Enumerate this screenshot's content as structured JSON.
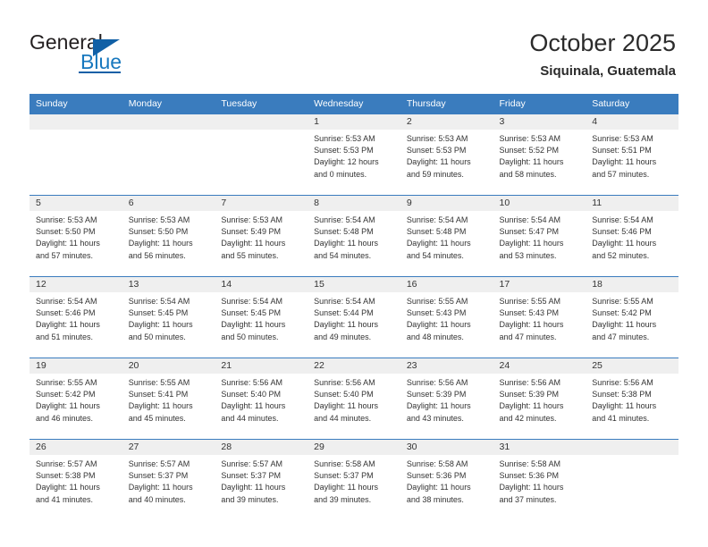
{
  "brand": {
    "name_part1": "General",
    "name_part2": "Blue",
    "accent_color": "#1160a6",
    "blue_text_color": "#1878be"
  },
  "header": {
    "title": "October 2025",
    "subtitle": "Siquinala, Guatemala"
  },
  "theme": {
    "header_row_bg": "#3a7cbe",
    "header_row_text": "#ffffff",
    "daynum_band_bg": "#efefef",
    "cell_bg": "#ffffff",
    "text_color": "#333333"
  },
  "labels": {
    "sunrise_prefix": "Sunrise:",
    "sunset_prefix": "Sunset:",
    "daylight_prefix": "Daylight:"
  },
  "weekday_headers": [
    "Sunday",
    "Monday",
    "Tuesday",
    "Wednesday",
    "Thursday",
    "Friday",
    "Saturday"
  ],
  "weeks": [
    [
      {
        "day": "",
        "sunrise": "",
        "sunset": "",
        "daylight_line1": "",
        "daylight_line2": ""
      },
      {
        "day": "",
        "sunrise": "",
        "sunset": "",
        "daylight_line1": "",
        "daylight_line2": ""
      },
      {
        "day": "",
        "sunrise": "",
        "sunset": "",
        "daylight_line1": "",
        "daylight_line2": ""
      },
      {
        "day": "1",
        "sunrise": "Sunrise: 5:53 AM",
        "sunset": "Sunset: 5:53 PM",
        "daylight_line1": "Daylight: 12 hours",
        "daylight_line2": "and 0 minutes."
      },
      {
        "day": "2",
        "sunrise": "Sunrise: 5:53 AM",
        "sunset": "Sunset: 5:53 PM",
        "daylight_line1": "Daylight: 11 hours",
        "daylight_line2": "and 59 minutes."
      },
      {
        "day": "3",
        "sunrise": "Sunrise: 5:53 AM",
        "sunset": "Sunset: 5:52 PM",
        "daylight_line1": "Daylight: 11 hours",
        "daylight_line2": "and 58 minutes."
      },
      {
        "day": "4",
        "sunrise": "Sunrise: 5:53 AM",
        "sunset": "Sunset: 5:51 PM",
        "daylight_line1": "Daylight: 11 hours",
        "daylight_line2": "and 57 minutes."
      }
    ],
    [
      {
        "day": "5",
        "sunrise": "Sunrise: 5:53 AM",
        "sunset": "Sunset: 5:50 PM",
        "daylight_line1": "Daylight: 11 hours",
        "daylight_line2": "and 57 minutes."
      },
      {
        "day": "6",
        "sunrise": "Sunrise: 5:53 AM",
        "sunset": "Sunset: 5:50 PM",
        "daylight_line1": "Daylight: 11 hours",
        "daylight_line2": "and 56 minutes."
      },
      {
        "day": "7",
        "sunrise": "Sunrise: 5:53 AM",
        "sunset": "Sunset: 5:49 PM",
        "daylight_line1": "Daylight: 11 hours",
        "daylight_line2": "and 55 minutes."
      },
      {
        "day": "8",
        "sunrise": "Sunrise: 5:54 AM",
        "sunset": "Sunset: 5:48 PM",
        "daylight_line1": "Daylight: 11 hours",
        "daylight_line2": "and 54 minutes."
      },
      {
        "day": "9",
        "sunrise": "Sunrise: 5:54 AM",
        "sunset": "Sunset: 5:48 PM",
        "daylight_line1": "Daylight: 11 hours",
        "daylight_line2": "and 54 minutes."
      },
      {
        "day": "10",
        "sunrise": "Sunrise: 5:54 AM",
        "sunset": "Sunset: 5:47 PM",
        "daylight_line1": "Daylight: 11 hours",
        "daylight_line2": "and 53 minutes."
      },
      {
        "day": "11",
        "sunrise": "Sunrise: 5:54 AM",
        "sunset": "Sunset: 5:46 PM",
        "daylight_line1": "Daylight: 11 hours",
        "daylight_line2": "and 52 minutes."
      }
    ],
    [
      {
        "day": "12",
        "sunrise": "Sunrise: 5:54 AM",
        "sunset": "Sunset: 5:46 PM",
        "daylight_line1": "Daylight: 11 hours",
        "daylight_line2": "and 51 minutes."
      },
      {
        "day": "13",
        "sunrise": "Sunrise: 5:54 AM",
        "sunset": "Sunset: 5:45 PM",
        "daylight_line1": "Daylight: 11 hours",
        "daylight_line2": "and 50 minutes."
      },
      {
        "day": "14",
        "sunrise": "Sunrise: 5:54 AM",
        "sunset": "Sunset: 5:45 PM",
        "daylight_line1": "Daylight: 11 hours",
        "daylight_line2": "and 50 minutes."
      },
      {
        "day": "15",
        "sunrise": "Sunrise: 5:54 AM",
        "sunset": "Sunset: 5:44 PM",
        "daylight_line1": "Daylight: 11 hours",
        "daylight_line2": "and 49 minutes."
      },
      {
        "day": "16",
        "sunrise": "Sunrise: 5:55 AM",
        "sunset": "Sunset: 5:43 PM",
        "daylight_line1": "Daylight: 11 hours",
        "daylight_line2": "and 48 minutes."
      },
      {
        "day": "17",
        "sunrise": "Sunrise: 5:55 AM",
        "sunset": "Sunset: 5:43 PM",
        "daylight_line1": "Daylight: 11 hours",
        "daylight_line2": "and 47 minutes."
      },
      {
        "day": "18",
        "sunrise": "Sunrise: 5:55 AM",
        "sunset": "Sunset: 5:42 PM",
        "daylight_line1": "Daylight: 11 hours",
        "daylight_line2": "and 47 minutes."
      }
    ],
    [
      {
        "day": "19",
        "sunrise": "Sunrise: 5:55 AM",
        "sunset": "Sunset: 5:42 PM",
        "daylight_line1": "Daylight: 11 hours",
        "daylight_line2": "and 46 minutes."
      },
      {
        "day": "20",
        "sunrise": "Sunrise: 5:55 AM",
        "sunset": "Sunset: 5:41 PM",
        "daylight_line1": "Daylight: 11 hours",
        "daylight_line2": "and 45 minutes."
      },
      {
        "day": "21",
        "sunrise": "Sunrise: 5:56 AM",
        "sunset": "Sunset: 5:40 PM",
        "daylight_line1": "Daylight: 11 hours",
        "daylight_line2": "and 44 minutes."
      },
      {
        "day": "22",
        "sunrise": "Sunrise: 5:56 AM",
        "sunset": "Sunset: 5:40 PM",
        "daylight_line1": "Daylight: 11 hours",
        "daylight_line2": "and 44 minutes."
      },
      {
        "day": "23",
        "sunrise": "Sunrise: 5:56 AM",
        "sunset": "Sunset: 5:39 PM",
        "daylight_line1": "Daylight: 11 hours",
        "daylight_line2": "and 43 minutes."
      },
      {
        "day": "24",
        "sunrise": "Sunrise: 5:56 AM",
        "sunset": "Sunset: 5:39 PM",
        "daylight_line1": "Daylight: 11 hours",
        "daylight_line2": "and 42 minutes."
      },
      {
        "day": "25",
        "sunrise": "Sunrise: 5:56 AM",
        "sunset": "Sunset: 5:38 PM",
        "daylight_line1": "Daylight: 11 hours",
        "daylight_line2": "and 41 minutes."
      }
    ],
    [
      {
        "day": "26",
        "sunrise": "Sunrise: 5:57 AM",
        "sunset": "Sunset: 5:38 PM",
        "daylight_line1": "Daylight: 11 hours",
        "daylight_line2": "and 41 minutes."
      },
      {
        "day": "27",
        "sunrise": "Sunrise: 5:57 AM",
        "sunset": "Sunset: 5:37 PM",
        "daylight_line1": "Daylight: 11 hours",
        "daylight_line2": "and 40 minutes."
      },
      {
        "day": "28",
        "sunrise": "Sunrise: 5:57 AM",
        "sunset": "Sunset: 5:37 PM",
        "daylight_line1": "Daylight: 11 hours",
        "daylight_line2": "and 39 minutes."
      },
      {
        "day": "29",
        "sunrise": "Sunrise: 5:58 AM",
        "sunset": "Sunset: 5:37 PM",
        "daylight_line1": "Daylight: 11 hours",
        "daylight_line2": "and 39 minutes."
      },
      {
        "day": "30",
        "sunrise": "Sunrise: 5:58 AM",
        "sunset": "Sunset: 5:36 PM",
        "daylight_line1": "Daylight: 11 hours",
        "daylight_line2": "and 38 minutes."
      },
      {
        "day": "31",
        "sunrise": "Sunrise: 5:58 AM",
        "sunset": "Sunset: 5:36 PM",
        "daylight_line1": "Daylight: 11 hours",
        "daylight_line2": "and 37 minutes."
      },
      {
        "day": "",
        "sunrise": "",
        "sunset": "",
        "daylight_line1": "",
        "daylight_line2": ""
      }
    ]
  ]
}
